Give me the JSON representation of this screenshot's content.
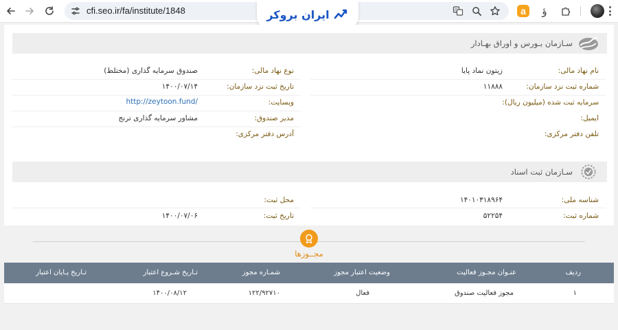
{
  "browser": {
    "url": "cfi.seo.ir/fa/institute/1848",
    "logo_text": "ایران بروکر",
    "ext_a": "a",
    "ext_v": "ؤ"
  },
  "sec1": {
    "title": "سـازمان بـورس و اوراق بهـادار",
    "right": [
      {
        "label": "نام نهاد مالی:",
        "value": "زیتون نماد پایا"
      },
      {
        "label": "شماره ثبت نزد سازمان:",
        "value": "۱۱۸۸۸"
      },
      {
        "label": "سرمایه ثبت شده (میلیون ریال):",
        "value": ""
      },
      {
        "label": "ایمیل:",
        "value": ""
      },
      {
        "label": "تلفن دفتر مرکزی:",
        "value": ""
      }
    ],
    "left": [
      {
        "label": "نوع نهاد مالی:",
        "value": "صندوق سرمایه گذاری (مختلط)"
      },
      {
        "label": "تاریخ ثبت نزد سازمان:",
        "value": "۱۴۰۰/۰۷/۱۴"
      },
      {
        "label": "وبسایت:",
        "value": "http://zeytoon.fund/"
      },
      {
        "label": "مدیر صندوق:",
        "value": "مشاور سرمایه گذاری ترنج"
      },
      {
        "label": "آدرس دفتر مرکزی:",
        "value": ""
      }
    ]
  },
  "sec2": {
    "title": "سـازمان ثبت اسناد",
    "right": [
      {
        "label": "شناسه ملی:",
        "value": "۱۴۰۱۰۳۱۸۹۶۴"
      },
      {
        "label": "شماره ثبت:",
        "value": "۵۲۲۵۴"
      }
    ],
    "left": [
      {
        "label": "محل ثبت:",
        "value": ""
      },
      {
        "label": "تاریخ ثبت:",
        "value": "۱۴۰۰/۰۷/۰۶"
      }
    ]
  },
  "licenses": {
    "title": "مجــوزها",
    "headers": [
      "ردیف",
      "عنـوان مجـوز فعالیت",
      "وضعیت اعتبار مجوز",
      "شمـاره مجوز",
      "تـاریخ شـروع اعتبار",
      "تـاریخ پـایان اعتبار"
    ],
    "rows": [
      [
        "۱",
        "مجوز فعالیت صندوق",
        "فعال",
        "۱۲۲/۹۲۷۱۰",
        "۱۴۰۰/۰۸/۱۲",
        ""
      ]
    ]
  },
  "colors": {
    "label": "#7a5a12",
    "link": "#2d6fb6",
    "table_header": "#6d7d8e",
    "badge": "#f19a1b"
  }
}
